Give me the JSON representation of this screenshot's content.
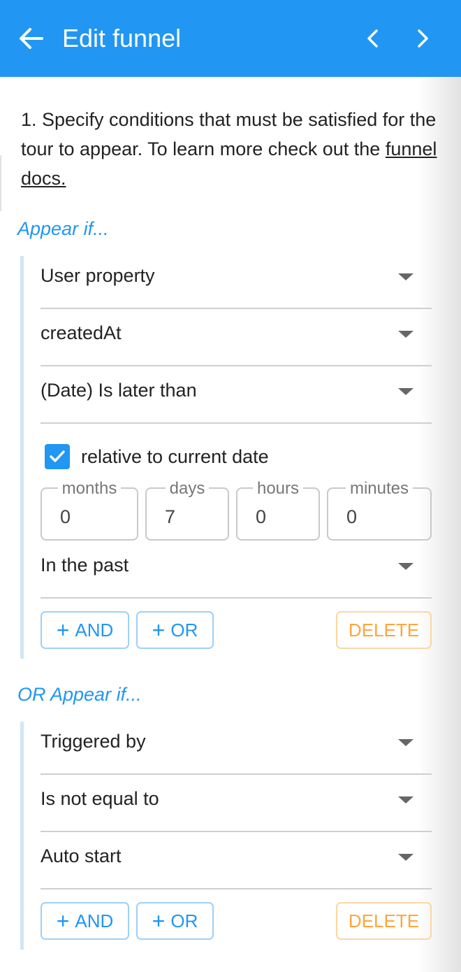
{
  "header": {
    "title": "Edit funnel"
  },
  "intro": {
    "text": "1. Specify conditions that must be satisfied for the tour to appear. To learn more check out the",
    "link": "funnel docs."
  },
  "groups": [
    {
      "title": "Appear if...",
      "rows": [
        {
          "value": "User property"
        },
        {
          "value": "createdAt"
        },
        {
          "value": "(Date) Is later than"
        }
      ],
      "relative": {
        "checked": true,
        "label": "relative to current date",
        "fields": [
          {
            "label": "months",
            "value": "0"
          },
          {
            "label": "days",
            "value": "7"
          },
          {
            "label": "hours",
            "value": "0"
          },
          {
            "label": "minutes",
            "value": "0"
          }
        ],
        "direction": "In the past"
      },
      "buttons": {
        "and": "AND",
        "or": "OR",
        "plus": "+",
        "delete": "DELETE"
      }
    },
    {
      "title": "OR Appear if...",
      "rows": [
        {
          "value": "Triggered by"
        },
        {
          "value": "Is not equal to"
        },
        {
          "value": "Auto start"
        }
      ],
      "buttons": {
        "and": "AND",
        "or": "OR",
        "plus": "+",
        "delete": "DELETE"
      }
    }
  ],
  "colors": {
    "primary": "#2196f3",
    "group_bar": "#cfe7f8",
    "delete": "#ffa63a",
    "divider": "#cfcfcf"
  }
}
